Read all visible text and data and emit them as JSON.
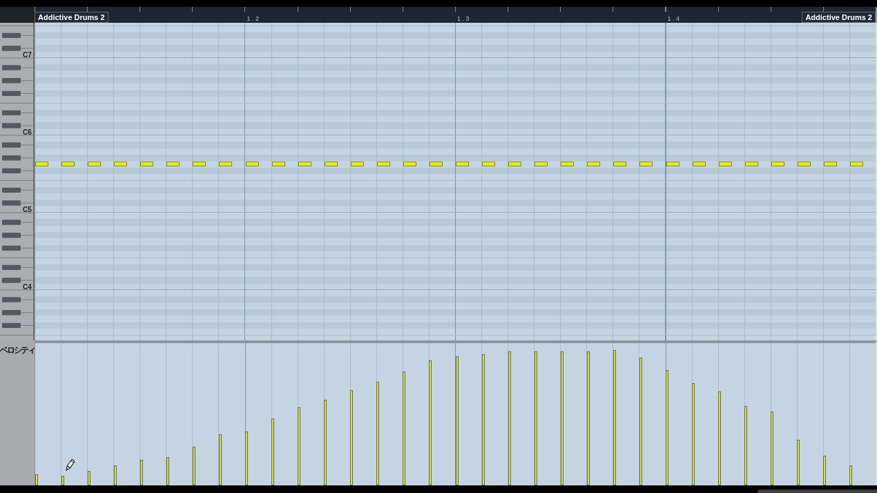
{
  "ruler": {
    "part_labels": [
      "Addictive Drums 2",
      "Addictive Drums 2"
    ],
    "bar_numbers": [
      "1.2",
      "1.3",
      "1.4"
    ]
  },
  "keyboard": {
    "octave_labels": [
      "C7",
      "C6",
      "C5",
      "C4"
    ]
  },
  "velocity_lane": {
    "title": "ベロシティ"
  },
  "notes": [
    {
      "level": 0.08
    },
    {
      "level": 0.07
    },
    {
      "level": 0.1
    },
    {
      "level": 0.14
    },
    {
      "level": 0.18
    },
    {
      "level": 0.2
    },
    {
      "level": 0.27
    },
    {
      "level": 0.36
    },
    {
      "level": 0.38
    },
    {
      "level": 0.47
    },
    {
      "level": 0.55
    },
    {
      "level": 0.6
    },
    {
      "level": 0.67
    },
    {
      "level": 0.73
    },
    {
      "level": 0.8
    },
    {
      "level": 0.88
    },
    {
      "level": 0.91
    },
    {
      "level": 0.92
    },
    {
      "level": 0.94
    },
    {
      "level": 0.94
    },
    {
      "level": 0.94
    },
    {
      "level": 0.94
    },
    {
      "level": 0.95
    },
    {
      "level": 0.9
    },
    {
      "level": 0.81
    },
    {
      "level": 0.72
    },
    {
      "level": 0.66
    },
    {
      "level": 0.56
    },
    {
      "level": 0.52
    },
    {
      "level": 0.32
    },
    {
      "level": 0.21
    },
    {
      "level": 0.14
    }
  ]
}
